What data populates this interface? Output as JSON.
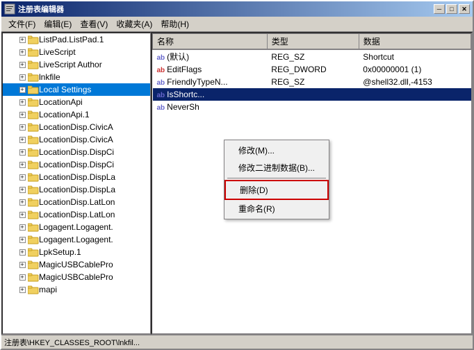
{
  "window": {
    "title": "注册表编辑器",
    "minimize_label": "─",
    "maximize_label": "□",
    "close_label": "✕"
  },
  "menubar": {
    "items": [
      {
        "label": "文件(F)"
      },
      {
        "label": "编辑(E)"
      },
      {
        "label": "查看(V)"
      },
      {
        "label": "收藏夹(A)"
      },
      {
        "label": "帮助(H)"
      }
    ]
  },
  "tree": {
    "items": [
      {
        "label": "ListPad.ListPad.1",
        "indent": 1,
        "expanded": false
      },
      {
        "label": "LiveScript",
        "indent": 1,
        "expanded": false
      },
      {
        "label": "LiveScript Author",
        "indent": 1,
        "expanded": false
      },
      {
        "label": "lnkfile",
        "indent": 1,
        "expanded": false
      },
      {
        "label": "Local Settings",
        "indent": 1,
        "expanded": false,
        "selected": true
      },
      {
        "label": "LocationApi",
        "indent": 1,
        "expanded": false
      },
      {
        "label": "LocationApi.1",
        "indent": 1,
        "expanded": false
      },
      {
        "label": "LocationDisp.CivicA",
        "indent": 1,
        "expanded": false
      },
      {
        "label": "LocationDisp.CivicA",
        "indent": 1,
        "expanded": false
      },
      {
        "label": "LocationDisp.DispCi",
        "indent": 1,
        "expanded": false
      },
      {
        "label": "LocationDisp.DispCi",
        "indent": 1,
        "expanded": false
      },
      {
        "label": "LocationDisp.DispLa",
        "indent": 1,
        "expanded": false
      },
      {
        "label": "LocationDisp.DispLa",
        "indent": 1,
        "expanded": false
      },
      {
        "label": "LocationDisp.LatLon",
        "indent": 1,
        "expanded": false
      },
      {
        "label": "LocationDisp.LatLon",
        "indent": 1,
        "expanded": false
      },
      {
        "label": "Logagent.Logagent.",
        "indent": 1,
        "expanded": false
      },
      {
        "label": "Logagent.Logagent.",
        "indent": 1,
        "expanded": false
      },
      {
        "label": "LpkSetup.1",
        "indent": 1,
        "expanded": false
      },
      {
        "label": "MagicUSBCablePro",
        "indent": 1,
        "expanded": false
      },
      {
        "label": "MagicUSBCablePro",
        "indent": 1,
        "expanded": false
      },
      {
        "label": "mapi",
        "indent": 1,
        "expanded": false
      }
    ]
  },
  "table": {
    "columns": [
      "名称",
      "类型",
      "数据"
    ],
    "rows": [
      {
        "icon": "ab",
        "icon_type": "normal",
        "name": "(默认)",
        "type": "REG_SZ",
        "data": "Shortcut"
      },
      {
        "icon": "ab",
        "icon_type": "dword",
        "name": "EditFlags",
        "type": "REG_DWORD",
        "data": "0x00000001 (1)"
      },
      {
        "icon": "ab",
        "icon_type": "normal",
        "name": "FriendlyTypeN...",
        "type": "REG_SZ",
        "data": "@shell32.dll,-4153"
      },
      {
        "icon": "ab",
        "icon_type": "normal",
        "name": "IsShortc...",
        "type": "",
        "data": "",
        "selected": true
      },
      {
        "icon": "ab",
        "icon_type": "normal",
        "name": "NeverSh",
        "type": "",
        "data": ""
      }
    ]
  },
  "context_menu": {
    "items": [
      {
        "label": "修改(M)...",
        "type": "normal"
      },
      {
        "label": "修改二进制数据(B)...",
        "type": "normal"
      },
      {
        "separator": true
      },
      {
        "label": "删除(D)",
        "type": "delete"
      },
      {
        "label": "重命名(R)",
        "type": "normal"
      }
    ]
  },
  "status_bar": {
    "text": "注册表\\HKEY_CLASSES_ROOT\\lnkfil..."
  }
}
